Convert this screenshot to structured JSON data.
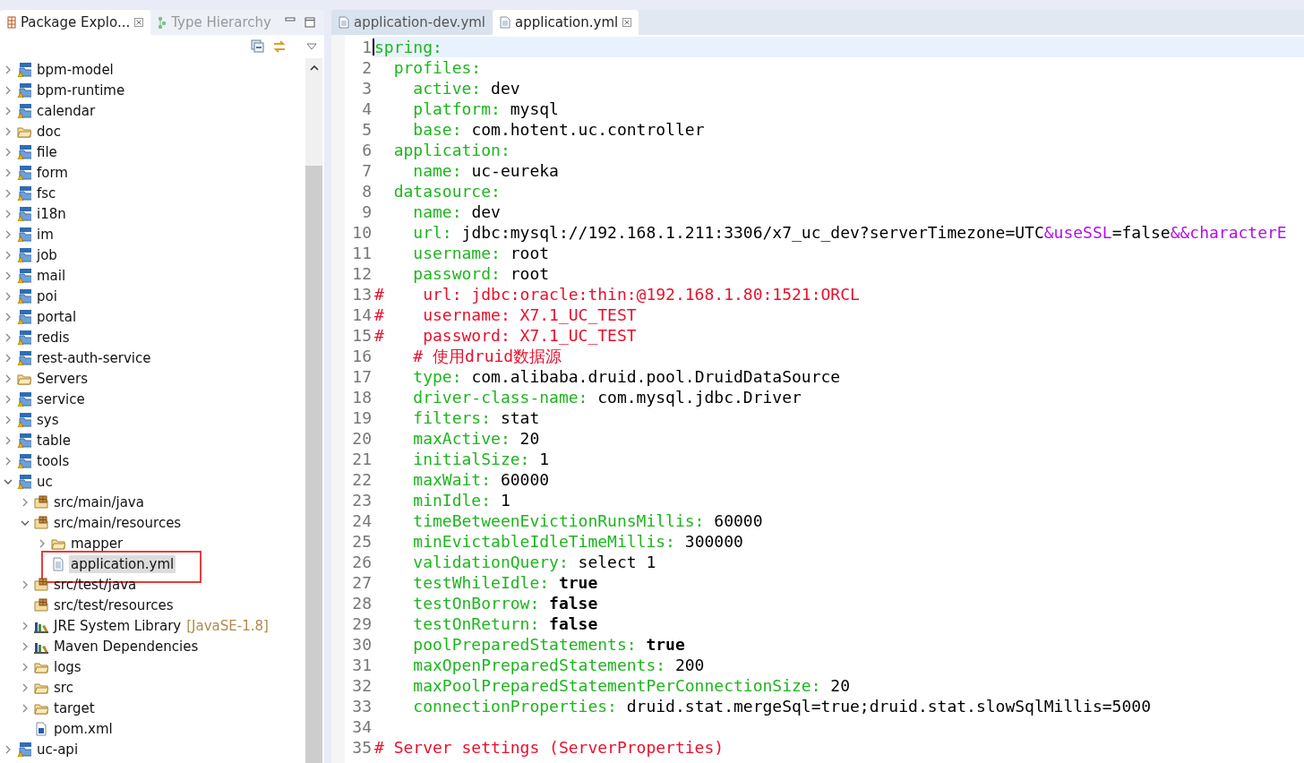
{
  "explorer": {
    "tabs": [
      {
        "label": "Package Explo...",
        "selected": true,
        "closable": true
      },
      {
        "label": "Type Hierarchy",
        "selected": false,
        "closable": false
      }
    ],
    "tree": [
      {
        "label": "bpm-model",
        "kind": "project",
        "expanded": false,
        "selected": false
      },
      {
        "label": "bpm-runtime",
        "kind": "project",
        "expanded": false,
        "selected": false
      },
      {
        "label": "calendar",
        "kind": "project",
        "expanded": false,
        "selected": false
      },
      {
        "label": "doc",
        "kind": "folder",
        "expanded": false,
        "selected": false
      },
      {
        "label": "file",
        "kind": "project",
        "expanded": false,
        "selected": false
      },
      {
        "label": "form",
        "kind": "project",
        "expanded": false,
        "selected": false
      },
      {
        "label": "fsc",
        "kind": "project",
        "expanded": false,
        "selected": false
      },
      {
        "label": "i18n",
        "kind": "project",
        "expanded": false,
        "selected": false
      },
      {
        "label": "im",
        "kind": "project",
        "expanded": false,
        "selected": false
      },
      {
        "label": "job",
        "kind": "project",
        "expanded": false,
        "selected": false
      },
      {
        "label": "mail",
        "kind": "project",
        "expanded": false,
        "selected": false
      },
      {
        "label": "poi",
        "kind": "project",
        "expanded": false,
        "selected": false
      },
      {
        "label": "portal",
        "kind": "project",
        "expanded": false,
        "selected": false
      },
      {
        "label": "redis",
        "kind": "project",
        "expanded": false,
        "selected": false
      },
      {
        "label": "rest-auth-service",
        "kind": "project",
        "expanded": false,
        "selected": false
      },
      {
        "label": "Servers",
        "kind": "folder",
        "expanded": false,
        "selected": false
      },
      {
        "label": "service",
        "kind": "project",
        "expanded": false,
        "selected": false
      },
      {
        "label": "sys",
        "kind": "project",
        "expanded": false,
        "selected": false
      },
      {
        "label": "table",
        "kind": "project",
        "expanded": false,
        "selected": false
      },
      {
        "label": "tools",
        "kind": "project",
        "expanded": false,
        "selected": false
      },
      {
        "label": "uc",
        "kind": "project",
        "expanded": true,
        "selected": false,
        "children": [
          {
            "label": "src/main/java",
            "kind": "source-folder",
            "expanded": false,
            "selected": false
          },
          {
            "label": "src/main/resources",
            "kind": "source-folder",
            "expanded": true,
            "selected": false,
            "children": [
              {
                "label": "mapper",
                "kind": "folder",
                "expanded": false,
                "selected": false
              },
              {
                "label": "application.yml",
                "kind": "file",
                "selected": true,
                "highlighted": true
              }
            ]
          },
          {
            "label": "src/test/java",
            "kind": "source-folder",
            "expanded": false,
            "selected": false
          },
          {
            "label": "src/test/resources",
            "kind": "source-folder",
            "selected": false
          },
          {
            "label": "JRE System Library",
            "decoration": "[JavaSE-1.8]",
            "kind": "library",
            "expanded": false,
            "selected": false
          },
          {
            "label": "Maven Dependencies",
            "kind": "library",
            "expanded": false,
            "selected": false
          },
          {
            "label": "logs",
            "kind": "folder",
            "expanded": false,
            "selected": false
          },
          {
            "label": "src",
            "kind": "folder",
            "expanded": false,
            "selected": false
          },
          {
            "label": "target",
            "kind": "folder",
            "expanded": false,
            "selected": false
          },
          {
            "label": "pom.xml",
            "kind": "maven-file",
            "selected": false
          }
        ]
      },
      {
        "label": "uc-api",
        "kind": "project",
        "expanded": false,
        "selected": false
      }
    ]
  },
  "editor": {
    "tabs": [
      {
        "label": "application-dev.yml",
        "selected": false,
        "closable": false
      },
      {
        "label": "application.yml",
        "selected": true,
        "closable": true
      }
    ],
    "lines": [
      {
        "number": "1",
        "current": true,
        "segments": [
          {
            "kind": "key",
            "text": "spring:"
          }
        ]
      },
      {
        "number": "2",
        "current": false,
        "segments": [
          {
            "kind": "key",
            "text": "  profiles:"
          }
        ]
      },
      {
        "number": "3",
        "current": false,
        "segments": [
          {
            "kind": "key",
            "text": "    active:"
          },
          {
            "kind": "value",
            "text": " dev"
          }
        ]
      },
      {
        "number": "4",
        "current": false,
        "segments": [
          {
            "kind": "key",
            "text": "    platform:"
          },
          {
            "kind": "value",
            "text": " mysql"
          }
        ]
      },
      {
        "number": "5",
        "current": false,
        "segments": [
          {
            "kind": "key",
            "text": "    base:"
          },
          {
            "kind": "value",
            "text": " com.hotent.uc.controller"
          }
        ]
      },
      {
        "number": "6",
        "current": false,
        "segments": [
          {
            "kind": "key",
            "text": "  application:"
          }
        ]
      },
      {
        "number": "7",
        "current": false,
        "segments": [
          {
            "kind": "key",
            "text": "    name:"
          },
          {
            "kind": "value",
            "text": " uc-eureka"
          }
        ]
      },
      {
        "number": "8",
        "current": false,
        "segments": [
          {
            "kind": "key",
            "text": "  datasource:"
          }
        ]
      },
      {
        "number": "9",
        "current": false,
        "segments": [
          {
            "kind": "key",
            "text": "    name:"
          },
          {
            "kind": "value",
            "text": " dev"
          }
        ]
      },
      {
        "number": "10",
        "current": false,
        "segments": [
          {
            "kind": "key",
            "text": "    url:"
          },
          {
            "kind": "value",
            "text": " jdbc:mysql://192.168.1.211:3306/x7_uc_dev?serverTimezone=UTC"
          },
          {
            "kind": "param",
            "text": "&useSSL"
          },
          {
            "kind": "value",
            "text": "=false"
          },
          {
            "kind": "param",
            "text": "&&characterE"
          }
        ]
      },
      {
        "number": "11",
        "current": false,
        "segments": [
          {
            "kind": "key",
            "text": "    username:"
          },
          {
            "kind": "value",
            "text": " root"
          }
        ]
      },
      {
        "number": "12",
        "current": false,
        "segments": [
          {
            "kind": "key",
            "text": "    password:"
          },
          {
            "kind": "value",
            "text": " root"
          }
        ]
      },
      {
        "number": "13",
        "current": false,
        "segments": [
          {
            "kind": "comment",
            "text": "#    url: jdbc:oracle:thin:@192.168.1.80:1521:ORCL"
          }
        ]
      },
      {
        "number": "14",
        "current": false,
        "segments": [
          {
            "kind": "comment",
            "text": "#    username: X7.1_UC_TEST"
          }
        ]
      },
      {
        "number": "15",
        "current": false,
        "segments": [
          {
            "kind": "comment",
            "text": "#    password: X7.1_UC_TEST"
          }
        ]
      },
      {
        "number": "16",
        "current": false,
        "segments": [
          {
            "kind": "comment",
            "text": "    # 使用druid数据源"
          }
        ]
      },
      {
        "number": "17",
        "current": false,
        "segments": [
          {
            "kind": "key",
            "text": "    type:"
          },
          {
            "kind": "value",
            "text": " com.alibaba.druid.pool.DruidDataSource"
          }
        ]
      },
      {
        "number": "18",
        "current": false,
        "segments": [
          {
            "kind": "key",
            "text": "    driver-class-name:"
          },
          {
            "kind": "value",
            "text": " com.mysql.jdbc.Driver"
          }
        ]
      },
      {
        "number": "19",
        "current": false,
        "segments": [
          {
            "kind": "key",
            "text": "    filters:"
          },
          {
            "kind": "value",
            "text": " stat"
          }
        ]
      },
      {
        "number": "20",
        "current": false,
        "segments": [
          {
            "kind": "key",
            "text": "    maxActive:"
          },
          {
            "kind": "value",
            "text": " 20"
          }
        ]
      },
      {
        "number": "21",
        "current": false,
        "segments": [
          {
            "kind": "key",
            "text": "    initialSize:"
          },
          {
            "kind": "value",
            "text": " 1"
          }
        ]
      },
      {
        "number": "22",
        "current": false,
        "segments": [
          {
            "kind": "key",
            "text": "    maxWait:"
          },
          {
            "kind": "value",
            "text": " 60000"
          }
        ]
      },
      {
        "number": "23",
        "current": false,
        "segments": [
          {
            "kind": "key",
            "text": "    minIdle:"
          },
          {
            "kind": "value",
            "text": " 1"
          }
        ]
      },
      {
        "number": "24",
        "current": false,
        "segments": [
          {
            "kind": "key",
            "text": "    timeBetweenEvictionRunsMillis:"
          },
          {
            "kind": "value",
            "text": " 60000"
          }
        ]
      },
      {
        "number": "25",
        "current": false,
        "segments": [
          {
            "kind": "key",
            "text": "    minEvictableIdleTimeMillis:"
          },
          {
            "kind": "value",
            "text": " 300000"
          }
        ]
      },
      {
        "number": "26",
        "current": false,
        "segments": [
          {
            "kind": "key",
            "text": "    validationQuery:"
          },
          {
            "kind": "value",
            "text": " select 1"
          }
        ]
      },
      {
        "number": "27",
        "current": false,
        "segments": [
          {
            "kind": "key",
            "text": "    testWhileIdle:"
          },
          {
            "kind": "boolean",
            "text": " true"
          }
        ]
      },
      {
        "number": "28",
        "current": false,
        "segments": [
          {
            "kind": "key",
            "text": "    testOnBorrow:"
          },
          {
            "kind": "boolean",
            "text": " false"
          }
        ]
      },
      {
        "number": "29",
        "current": false,
        "segments": [
          {
            "kind": "key",
            "text": "    testOnReturn:"
          },
          {
            "kind": "boolean",
            "text": " false"
          }
        ]
      },
      {
        "number": "30",
        "current": false,
        "segments": [
          {
            "kind": "key",
            "text": "    poolPreparedStatements:"
          },
          {
            "kind": "boolean",
            "text": " true"
          }
        ]
      },
      {
        "number": "31",
        "current": false,
        "segments": [
          {
            "kind": "key",
            "text": "    maxOpenPreparedStatements:"
          },
          {
            "kind": "value",
            "text": " 200"
          }
        ]
      },
      {
        "number": "32",
        "current": false,
        "segments": [
          {
            "kind": "key",
            "text": "    maxPoolPreparedStatementPerConnectionSize:"
          },
          {
            "kind": "value",
            "text": " 20"
          }
        ]
      },
      {
        "number": "33",
        "current": false,
        "segments": [
          {
            "kind": "key",
            "text": "    connectionProperties:"
          },
          {
            "kind": "value",
            "text": " druid.stat.mergeSql=true;druid.stat.slowSqlMillis=5000"
          }
        ]
      },
      {
        "number": "34",
        "current": false
      },
      {
        "number": "35",
        "current": false,
        "segments": [
          {
            "kind": "comment",
            "text": "# Server settings (ServerProperties)"
          }
        ]
      }
    ]
  }
}
